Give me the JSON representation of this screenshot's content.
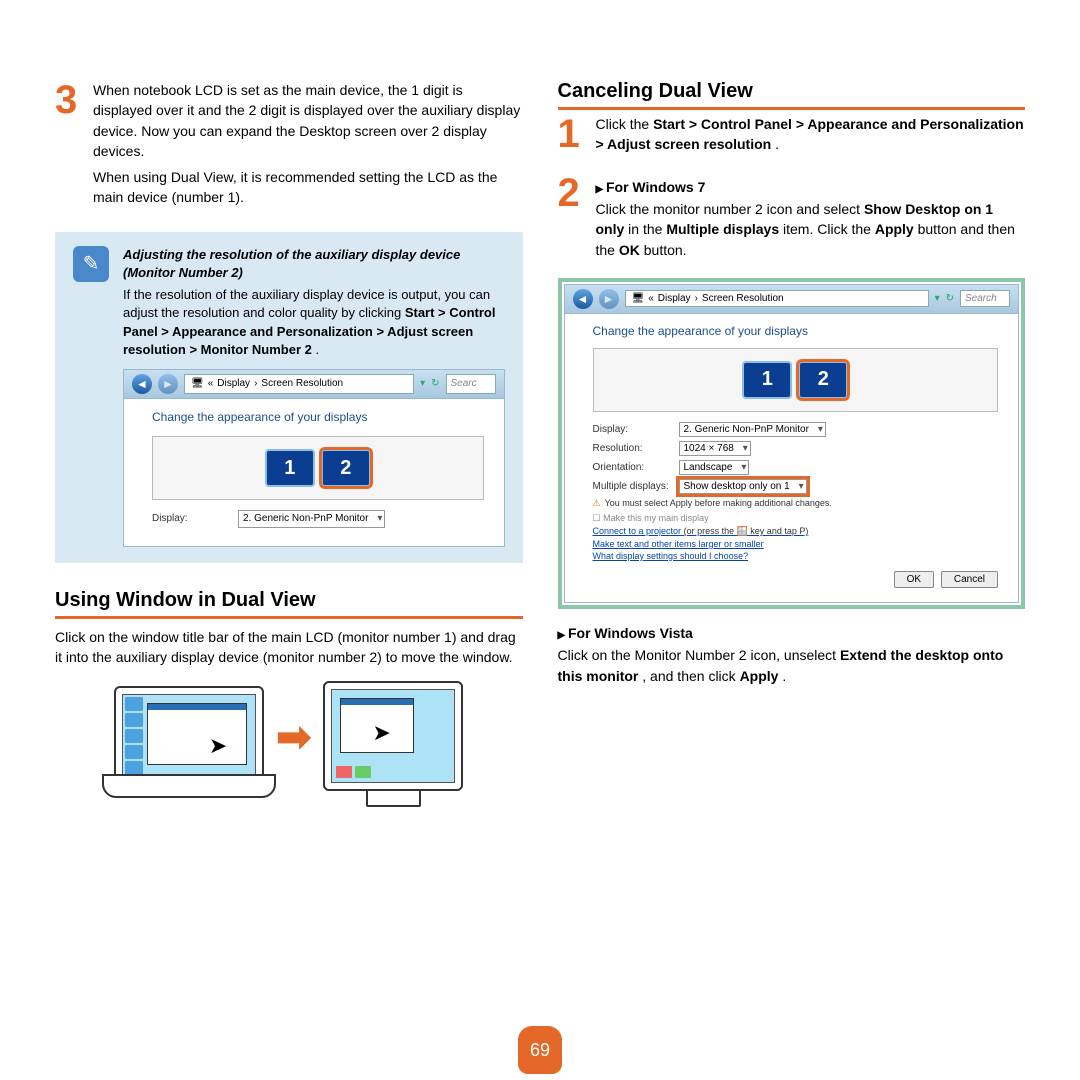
{
  "pageNumber": "69",
  "left": {
    "step3": {
      "num": "3",
      "p1_a": "When notebook LCD is set as the main device, the 1 digit is displayed over it and the 2 digit is displayed over the auxiliary display device. Now you can expand the Desktop screen over 2 display devices.",
      "p1_b": "When using Dual View, it is recommended setting the LCD as the main device (number 1)."
    },
    "note": {
      "title": "Adjusting the resolution of the auxiliary display device (Monitor Number 2)",
      "pre": "If the resolution of the auxiliary display device is output, you can adjust the resolution and color quality by clicking ",
      "bold": "Start > Control Panel > Appearance and Personalization > Adjust screen resolution > Monitor Number 2",
      "post": "."
    },
    "win1": {
      "bc1": "Display",
      "bc2": "Screen Resolution",
      "search": "Searc",
      "heading": "Change the appearance of your displays",
      "m1": "1",
      "m2": "2",
      "displayLabel": "Display:",
      "displayVal": "2. Generic Non-PnP Monitor"
    },
    "section2": "Using Window in Dual View",
    "section2_text": "Click on the window title bar of the main LCD (monitor number 1) and drag it into the auxiliary display device (monitor number 2) to move the window."
  },
  "right": {
    "title": "Canceling Dual View",
    "step1": {
      "num": "1",
      "pre": "Click the ",
      "bold": "Start > Control Panel > Appearance and Personalization > Adjust screen resolution",
      "post": "."
    },
    "step2": {
      "num": "2",
      "bullet": "For Windows 7",
      "pre": "Click the monitor number 2 icon and select ",
      "b1": "Show Desktop on 1 only",
      "mid": " in the ",
      "b2": "Multiple displays",
      "post1": " item. Click the ",
      "b3": "Apply",
      "post2": " button and then the ",
      "b4": "OK",
      "post3": " button."
    },
    "win2": {
      "bc1": "Display",
      "bc2": "Screen Resolution",
      "search": "Search",
      "heading": "Change the appearance of your displays",
      "m1": "1",
      "m2": "2",
      "displayLabel": "Display:",
      "displayVal": "2. Generic Non-PnP Monitor",
      "resLabel": "Resolution:",
      "resVal": "1024 × 768",
      "orientLabel": "Orientation:",
      "orientVal": "Landscape",
      "multiLabel": "Multiple displays:",
      "multiVal": "Show desktop only on 1",
      "warn": "You must select Apply before making additional changes.",
      "chk": "Make this my main display",
      "link1a": "Connect to a projector",
      "link1b": "(or press the 🪟 key and tap P)",
      "link2": "Make text and other items larger or smaller",
      "link3": "What display settings should I choose?",
      "ok": "OK",
      "cancel": "Cancel"
    },
    "vista": {
      "bullet": "For Windows Vista",
      "pre": "Click on the Monitor Number 2 icon, unselect ",
      "b1": "Extend the desktop onto this monitor",
      "mid": ", and then click ",
      "b2": "Apply",
      "post": "."
    }
  }
}
